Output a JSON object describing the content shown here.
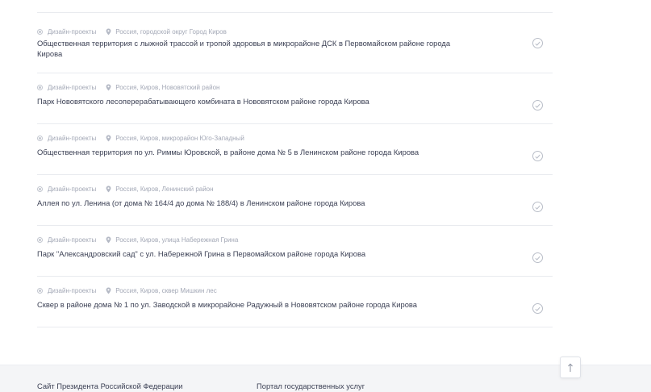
{
  "projects": [
    {
      "category": "Дизайн-проекты",
      "location": "Россия, городской округ Город Киров",
      "title": "Общественная территория с лыжной трассой и тропой здоровья в микрорайоне ДСК в Первомайском районе города Кирова"
    },
    {
      "category": "Дизайн-проекты",
      "location": "Россия, Киров, Нововятский район",
      "title": "Парк Нововятского лесоперерабатывающего комбината в Нововятском районе города Кирова"
    },
    {
      "category": "Дизайн-проекты",
      "location": "Россия, Киров, микрорайон Юго-Западный",
      "title": "Общественная территория по ул. Риммы Юровской, в районе дома № 5 в Ленинском районе города Кирова"
    },
    {
      "category": "Дизайн-проекты",
      "location": "Россия, Киров, Ленинский район",
      "title": "Аллея по ул. Ленина (от дома № 164/4 до дома № 188/4) в Ленинском районе города Кирова"
    },
    {
      "category": "Дизайн-проекты",
      "location": "Россия, Киров, улица Набережная Грина",
      "title": "Парк \"Александровский сад\" с ул. Набережной Грина в Первомайском районе города Кирова"
    },
    {
      "category": "Дизайн-проекты",
      "location": "Россия, Киров, сквер Мишкин лес",
      "title": "Сквер в районе дома № 1 по ул. Заводской в микрорайоне Радужный в Нововятском районе города Кирова"
    }
  ],
  "footer": {
    "link_president": "Сайт Президента Российской Федерации",
    "link_gosuslugi": "Портал государственных услуг"
  },
  "icons": {
    "category": "circle-dot-icon",
    "location": "map-pin-icon",
    "status": "check-circle-icon",
    "scroll_top": "arrow-up-icon"
  },
  "colors": {
    "text": "#3c4155",
    "meta": "#a3a8b6",
    "divider": "#e9ebef",
    "footer_bg": "#f4f5f7"
  }
}
